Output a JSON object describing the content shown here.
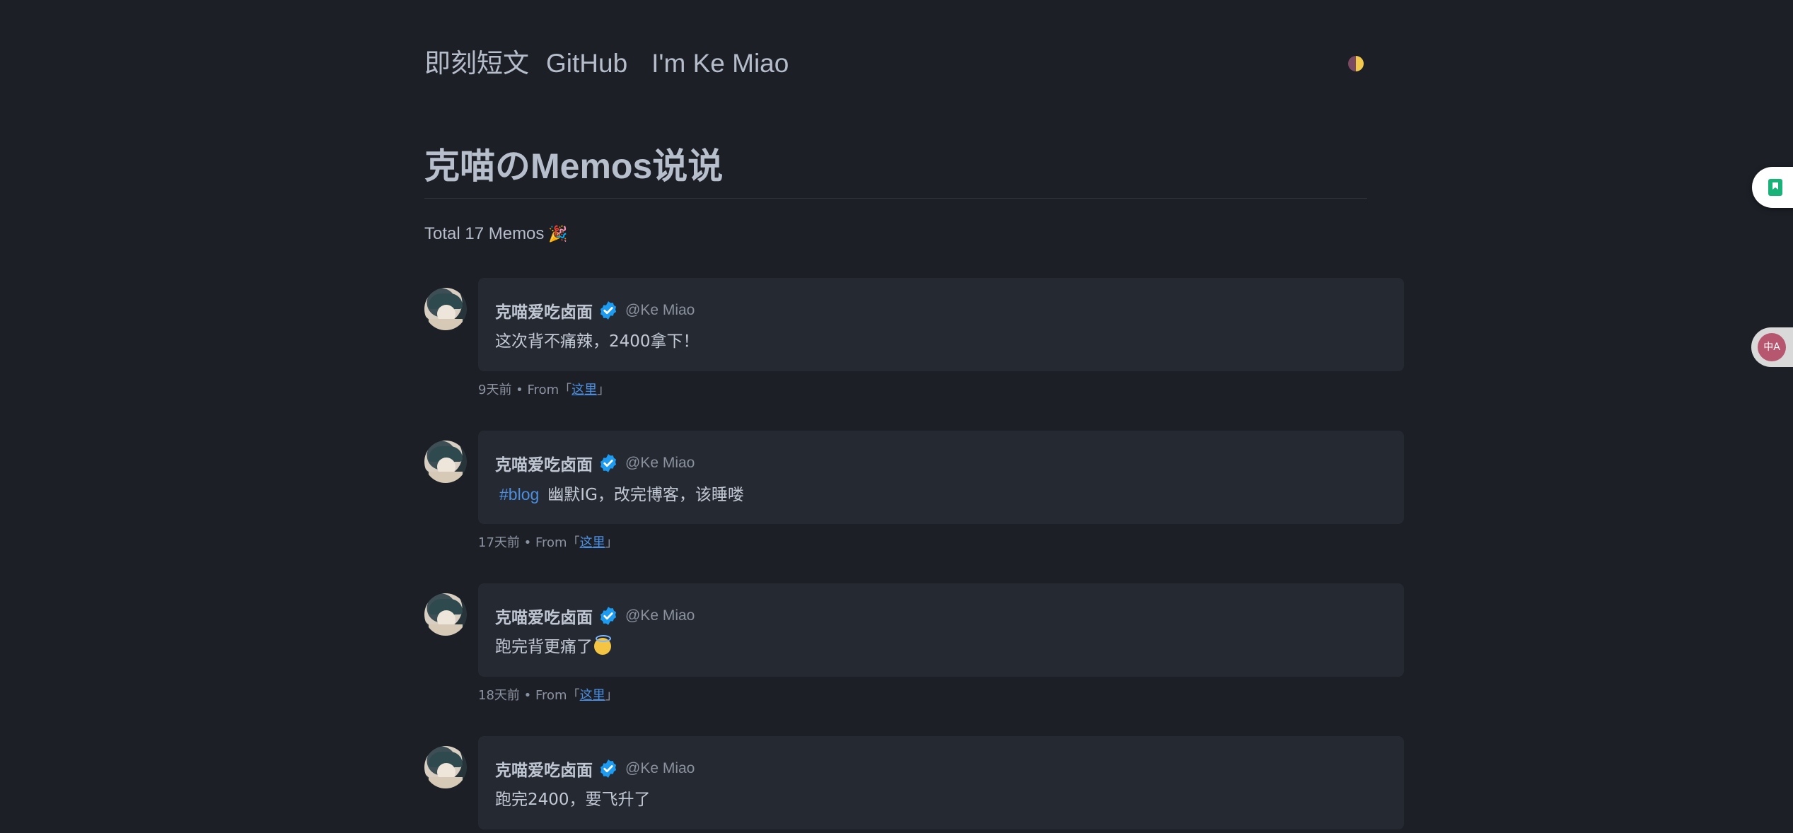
{
  "nav": {
    "items": [
      {
        "label": "即刻短文"
      },
      {
        "label": "GitHub"
      },
      {
        "label": "I'm Ke Miao"
      }
    ]
  },
  "header": {
    "title": "克喵のMemos说说",
    "total_text": "Total 17 Memos"
  },
  "memos": [
    {
      "author": "克喵爱吃卤面",
      "handle": "@Ke Miao",
      "tag": "",
      "text": "这次背不痛辣，2400拿下！",
      "time": "9天前",
      "from_label": "From「",
      "from_link": "这里",
      "from_close": "」"
    },
    {
      "author": "克喵爱吃卤面",
      "handle": "@Ke Miao",
      "tag": "#blog",
      "text": "幽默IG，改完博客，该睡喽",
      "time": "17天前",
      "from_label": "From「",
      "from_link": "这里",
      "from_close": "」"
    },
    {
      "author": "克喵爱吃卤面",
      "handle": "@Ke Miao",
      "tag": "",
      "text": "跑完背更痛了",
      "time": "18天前",
      "from_label": "From「",
      "from_link": "这里",
      "from_close": "」"
    },
    {
      "author": "克喵爱吃卤面",
      "handle": "@Ke Miao",
      "tag": "",
      "text": "跑完2400，要飞升了",
      "time": "",
      "from_label": "",
      "from_link": "",
      "from_close": ""
    }
  ],
  "side": {
    "translate_label": "中A"
  },
  "colors": {
    "background": "#1c1f26",
    "card": "#252932",
    "link": "#4c8fe0",
    "verified": "#1d9bf0"
  }
}
